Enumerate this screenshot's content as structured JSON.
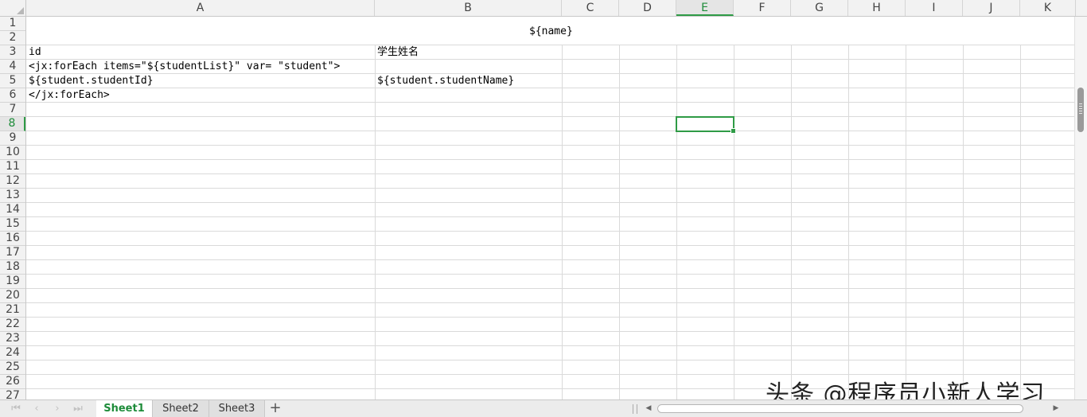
{
  "columns": [
    "A",
    "B",
    "C",
    "D",
    "E",
    "F",
    "G",
    "H",
    "I",
    "J",
    "K"
  ],
  "active_column": "E",
  "rows": [
    "1",
    "2",
    "3",
    "4",
    "5",
    "6",
    "7",
    "8",
    "9",
    "10",
    "11",
    "12",
    "13",
    "14",
    "15",
    "16",
    "17",
    "18",
    "19",
    "20",
    "21",
    "22",
    "23",
    "24",
    "25",
    "26",
    "27"
  ],
  "active_row": "8",
  "cells": {
    "title": "${name}",
    "a3": "id",
    "b3": "学生姓名",
    "a4": "<jx:forEach items=\"${studentList}\" var= \"student\">",
    "a5": "${student.studentId}",
    "b5": "${student.studentName}",
    "a6": "</jx:forEach>"
  },
  "tabs": [
    "Sheet1",
    "Sheet2",
    "Sheet3"
  ],
  "active_tab": "Sheet1",
  "add_tab_label": "+",
  "watermark": "头条 @程序员小新人学习",
  "colors": {
    "accent": "#2f9b46",
    "grid": "#dadada",
    "header_bg": "#f2f2f2"
  }
}
